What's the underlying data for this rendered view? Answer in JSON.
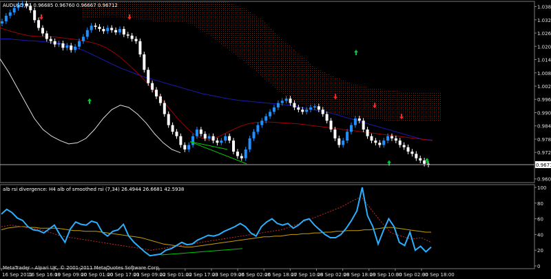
{
  "main_header": "AUDUSD,H1  0.96685 0.96760 0.96667 0.96712",
  "price_badge": "0.96712",
  "sub_header": "alb rsi divergence: H4  alb of smoothed rsi  (7,34) 26.4944 26.6681 42.5938",
  "footer": "MetaTrader - Alpari UK, © 2001-2011 MetaQuotes Software Corp.",
  "colors": {
    "background": "#000000",
    "bull": "#1e90ff",
    "bear": "#ffffff",
    "blue_ma": "#1a1ab0",
    "red_ma": "#a00000",
    "white_band": "#e0e0e0",
    "cloud": "#8b2500",
    "up_arrow": "#00cc33",
    "down_arrow": "#ff2222",
    "rsi": "#2ab0ff",
    "rsi_signal": "#c8a000",
    "rsi_red": "#cc2a2a",
    "div_line": "#00cc00"
  },
  "chart_data": [
    {
      "type": "line",
      "symbol": "AUDUSD",
      "timeframe": "H1",
      "title": "AUDUSD,H1",
      "ohlc_last": {
        "open": 0.96685,
        "high": 0.9676,
        "low": 0.96667,
        "close": 0.96712
      },
      "y_ticks": [
        "1.03865",
        "1.03265",
        "1.02665",
        "1.02065",
        "1.01465",
        "1.00865",
        "1.00265",
        "0.99665",
        "0.99065",
        "0.98465",
        "0.97865",
        "0.97265",
        "0.96712",
        "0.96065"
      ],
      "ylim": [
        0.959,
        1.041
      ],
      "x_ticks": [
        "16 Sep 2011",
        "16 Sep 16:00",
        "19 Sep 09:00",
        "20 Sep 01:00",
        "20 Sep 17:00",
        "21 Sep 09:00",
        "22 Sep 01:00",
        "22 Sep 17:00",
        "23 Sep 09:00",
        "26 Sep 02:00",
        "26 Sep 18:00",
        "27 Sep 10:00",
        "28 Sep 02:00",
        "28 Sep 18:00",
        "29 Sep 10:00",
        "30 Sep 02:00",
        "30 Sep 18:00"
      ],
      "close": [
        1.032,
        1.0345,
        1.036,
        1.038,
        1.0395,
        1.04,
        1.039,
        1.037,
        1.0325,
        1.029,
        1.0265,
        1.024,
        1.023,
        1.0215,
        1.022,
        1.02,
        1.021,
        1.019,
        1.0205,
        1.023,
        1.025,
        1.028,
        1.03,
        1.0295,
        1.0285,
        1.0275,
        1.029,
        1.028,
        1.027,
        1.0285,
        1.026,
        1.0255,
        1.024,
        1.023,
        1.017,
        1.01,
        1.004,
        1.001,
        0.998,
        0.995,
        0.99,
        0.985,
        0.982,
        0.98,
        0.976,
        0.974,
        0.976,
        0.98,
        0.983,
        0.981,
        0.979,
        0.98,
        0.978,
        0.977,
        0.978,
        0.98,
        0.978,
        0.973,
        0.971,
        0.97,
        0.974,
        0.979,
        0.982,
        0.985,
        0.987,
        0.989,
        0.991,
        0.993,
        0.995,
        0.996,
        0.997,
        0.995,
        0.993,
        0.992,
        0.991,
        0.992,
        0.993,
        0.9935,
        0.992,
        0.99,
        0.987,
        0.983,
        0.979,
        0.976,
        0.978,
        0.982,
        0.985,
        0.988,
        0.987,
        0.983,
        0.98,
        0.978,
        0.977,
        0.976,
        0.978,
        0.98,
        0.979,
        0.978,
        0.976,
        0.975,
        0.973,
        0.972,
        0.97,
        0.969,
        0.9675,
        0.9671
      ],
      "series": [
        {
          "values": [
            1.024,
            1.024,
            1.024,
            1.0238,
            1.0236,
            1.0234,
            1.0232,
            1.0232,
            1.023,
            1.0228,
            1.0226,
            1.0224,
            1.0222,
            1.022,
            1.0216,
            1.021,
            1.0204,
            1.0196,
            1.019,
            1.018,
            1.017,
            1.016,
            1.015,
            1.014,
            1.013,
            1.012,
            1.011,
            1.0102,
            1.0094,
            1.0086,
            1.0078,
            1.007,
            1.0064,
            1.0058,
            1.0052,
            1.0046,
            1.004,
            1.0034,
            1.0028,
            1.0022,
            1.0016,
            1.001,
            1.0004,
            0.9998,
            0.9992,
            0.9988,
            0.9984,
            0.998,
            0.9976,
            0.9972,
            0.9968,
            0.9965,
            0.9962,
            0.996,
            0.9958,
            0.9956,
            0.9954,
            0.9952,
            0.995,
            0.9948,
            0.9946,
            0.9944,
            0.9942,
            0.994,
            0.9936,
            0.9932,
            0.9928,
            0.9924,
            0.992,
            0.9916,
            0.9912,
            0.9908,
            0.9904,
            0.9898,
            0.9892,
            0.9886,
            0.988,
            0.9874,
            0.9868,
            0.9862,
            0.9856,
            0.985,
            0.9844,
            0.9838,
            0.9832,
            0.9826,
            0.982,
            0.9814,
            0.9808,
            0.9802,
            0.9796,
            0.979,
            0.9786,
            0.9784,
            0.9782
          ]
        },
        {
          "values": [
            1.029,
            1.028,
            1.027,
            1.0262,
            1.0255,
            1.0252,
            1.025,
            1.025,
            1.0248,
            1.0244,
            1.024,
            1.0236,
            1.023,
            1.0224,
            1.0214,
            1.02,
            1.018,
            1.0156,
            1.0128,
            1.0098,
            1.0066,
            1.0032,
            0.9996,
            0.9958,
            0.992,
            0.9882,
            0.9848,
            0.9818,
            0.9796,
            0.9786,
            0.9788,
            0.98,
            0.9816,
            0.9832,
            0.9846,
            0.9856,
            0.9862,
            0.9864,
            0.9864,
            0.9862,
            0.986,
            0.9858,
            0.9856,
            0.9852,
            0.9848,
            0.9844,
            0.984,
            0.9836,
            0.9832,
            0.9828,
            0.9824,
            0.982,
            0.9816,
            0.9812,
            0.9808,
            0.9804,
            0.98,
            0.9796,
            0.9792,
            0.9788,
            0.9784,
            0.978
          ]
        },
        {
          "values": [
            1.015,
            1.009,
            1.002,
            0.995,
            0.988,
            0.983,
            0.98,
            0.978,
            0.9765,
            0.977,
            0.979,
            0.983,
            0.988,
            0.992,
            0.994,
            0.993,
            0.99,
            0.986,
            0.981,
            0.977,
            0.974,
            0.9725
          ]
        }
      ],
      "cloud": {
        "upper": [
          1.041,
          1.041,
          1.041,
          1.041,
          1.041,
          1.041,
          1.041,
          1.041,
          1.041,
          1.038,
          1.033,
          1.025,
          1.018,
          1.011,
          1.007,
          1.004,
          1.002,
          1.001,
          1.0,
          0.9998,
          0.9995
        ],
        "lower": [
          1.033,
          1.034,
          1.034,
          1.033,
          1.032,
          1.032,
          1.031,
          1.026,
          1.02,
          1.014,
          1.007,
          1.0,
          0.995,
          0.992,
          0.99,
          0.989,
          0.988,
          0.987,
          0.987,
          0.987,
          0.987
        ]
      },
      "up_arrows": [
        0.999,
        1.021,
        0.971,
        0.972
      ],
      "down_arrows": [
        1.032,
        1.032,
        0.996,
        0.992,
        0.987
      ]
    },
    {
      "type": "line",
      "title": "alb rsi divergence: H4",
      "y_ticks": [
        "100",
        "80",
        "60",
        "40",
        "20",
        "0"
      ],
      "ylim": [
        0,
        100
      ],
      "rsi": [
        66,
        72,
        68,
        61,
        58,
        50,
        46,
        45,
        42,
        47,
        52,
        40,
        30,
        47,
        56,
        53,
        52,
        57,
        55,
        43,
        38,
        44,
        46,
        53,
        38,
        30,
        24,
        18,
        13,
        14,
        15,
        20,
        22,
        26,
        30,
        27,
        28,
        33,
        36,
        39,
        38,
        40,
        44,
        47,
        50,
        54,
        50,
        42,
        38,
        50,
        56,
        60,
        54,
        52,
        54,
        48,
        52,
        58,
        60,
        52,
        46,
        40,
        36,
        36,
        40,
        48,
        58,
        70,
        100,
        64,
        50,
        28,
        45,
        60,
        50,
        30,
        26,
        43,
        20,
        25,
        18,
        24
      ],
      "signal": [
        46,
        48,
        49,
        50,
        50,
        49,
        49,
        48,
        48,
        48,
        48,
        47,
        46,
        45,
        45,
        44,
        44,
        44,
        43,
        42,
        41,
        40,
        39,
        38,
        37,
        36,
        34,
        32,
        30,
        28,
        27,
        26,
        25,
        24,
        24,
        25,
        26,
        27,
        28,
        29,
        30,
        31,
        32,
        33,
        34,
        35,
        36,
        37,
        37,
        38,
        38,
        39,
        40,
        40,
        41,
        41,
        42,
        42,
        43,
        43,
        44,
        44,
        45,
        45,
        45,
        46,
        46,
        47,
        48,
        49,
        49,
        48,
        47,
        46,
        45,
        44,
        43,
        43
      ],
      "divergence_line": [
        50,
        52,
        50,
        48,
        46,
        42,
        38,
        36,
        34,
        32,
        30,
        28,
        26,
        24,
        22,
        20,
        22,
        24,
        26,
        28,
        30,
        32,
        34,
        36,
        38,
        40,
        42,
        44,
        46,
        50,
        55,
        60,
        65,
        70,
        75,
        82,
        88,
        72,
        56,
        42,
        38,
        34,
        36,
        30
      ]
    }
  ]
}
